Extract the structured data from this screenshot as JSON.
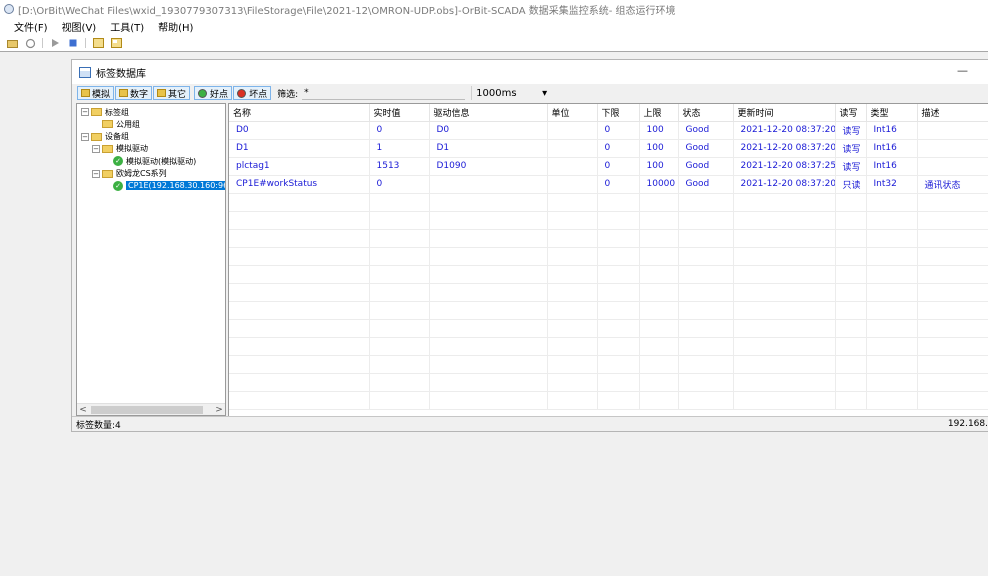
{
  "window": {
    "title": "[D:\\OrBit\\WeChat Files\\wxid_1930779307313\\FileStorage\\File\\2021-12\\OMRON-UDP.obs]-OrBit-SCADA 数据采集监控系统- 组态运行环境"
  },
  "menu": [
    "文件(F)",
    "视图(V)",
    "工具(T)",
    "帮助(H)"
  ],
  "child_window": {
    "title": "标签数据库",
    "minimize_label": "—"
  },
  "filter": {
    "type_buttons": [
      "模拟",
      "数字",
      "其它"
    ],
    "good_label": "好点",
    "bad_label": "坏点",
    "filter_label": "筛选:",
    "filter_value": "*",
    "interval": "1000ms"
  },
  "tree": [
    {
      "label": "标签组",
      "expander": "−",
      "level": 0,
      "icon": "folder"
    },
    {
      "label": "公用组",
      "expander": "",
      "level": 1,
      "icon": "folder"
    },
    {
      "label": "设备组",
      "expander": "−",
      "level": 0,
      "icon": "folder"
    },
    {
      "label": "模拟驱动",
      "expander": "−",
      "level": 1,
      "icon": "folder"
    },
    {
      "label": "模拟驱动(模拟驱动)",
      "expander": "",
      "level": 2,
      "icon": "ok"
    },
    {
      "label": "欧姆龙CS系列",
      "expander": "−",
      "level": 1,
      "icon": "folder"
    },
    {
      "label": "CP1E(192.168.30.160:96",
      "expander": "",
      "level": 2,
      "icon": "ok",
      "selected": true
    }
  ],
  "table": {
    "columns": [
      "名称",
      "实时值",
      "驱动信息",
      "单位",
      "下限",
      "上限",
      "状态",
      "更新时间",
      "读写",
      "类型",
      "描述"
    ],
    "rows": [
      [
        "D0",
        "0",
        "D0",
        "",
        "0",
        "100",
        "Good",
        "2021-12-20 08:37:20",
        "读写",
        "Int16",
        ""
      ],
      [
        "D1",
        "1",
        "D1",
        "",
        "0",
        "100",
        "Good",
        "2021-12-20 08:37:20",
        "读写",
        "Int16",
        ""
      ],
      [
        "plctag1",
        "1513",
        "D1090",
        "",
        "0",
        "100",
        "Good",
        "2021-12-20 08:37:25",
        "读写",
        "Int16",
        ""
      ],
      [
        "CP1E#workStatus",
        "0",
        "",
        "",
        "0",
        "10000",
        "Good",
        "2021-12-20 08:37:20",
        "只读",
        "Int32",
        "通讯状态"
      ]
    ],
    "empty_rows": 12
  },
  "status": {
    "count_text": "标签数量:4",
    "ip_text": "192.168."
  },
  "colors": {
    "accent": "#0078d7",
    "data_text": "#1a1ad6",
    "good": "#3cb043",
    "bad": "#d93025"
  }
}
